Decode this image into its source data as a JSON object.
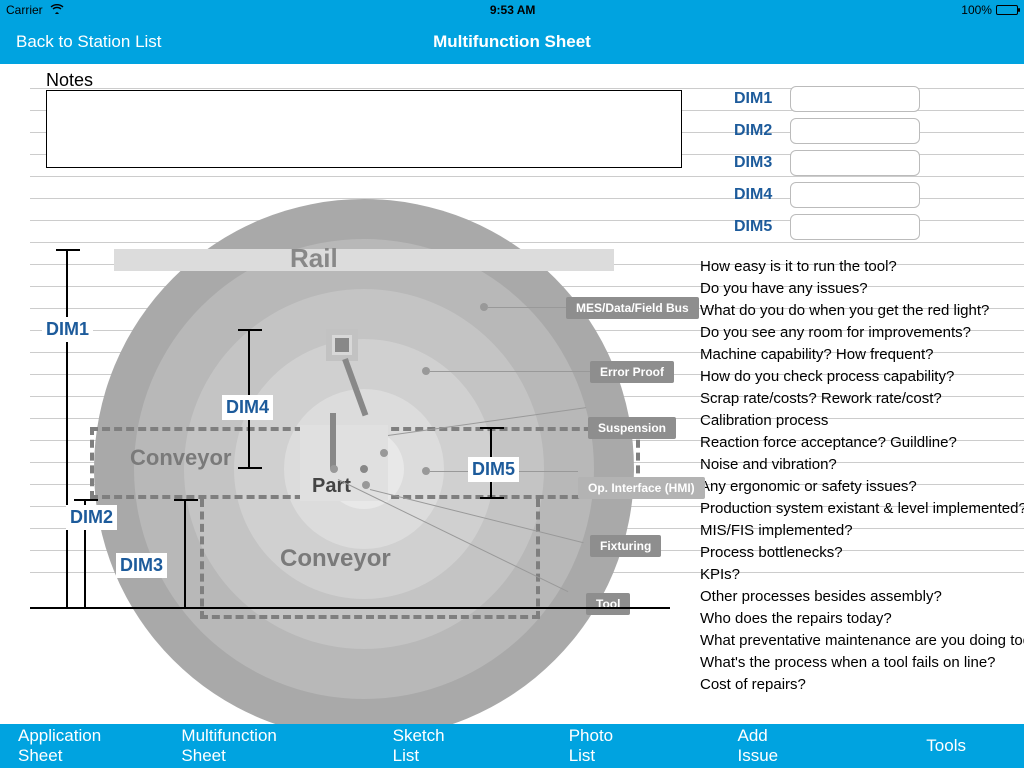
{
  "status": {
    "carrier": "Carrier",
    "time": "9:53 AM",
    "battery": "100%"
  },
  "nav": {
    "back": "Back to Station List",
    "title": "Multifunction Sheet"
  },
  "notes": {
    "label": "Notes",
    "value": ""
  },
  "dims": {
    "d1": {
      "label": "DIM1",
      "value": ""
    },
    "d2": {
      "label": "DIM2",
      "value": ""
    },
    "d3": {
      "label": "DIM3",
      "value": ""
    },
    "d4": {
      "label": "DIM4",
      "value": ""
    },
    "d5": {
      "label": "DIM5",
      "value": ""
    }
  },
  "diagram": {
    "rail": "Rail",
    "conveyor1": "Conveyor",
    "conveyor2": "Conveyor",
    "part": "Part",
    "dim1": "DIM1",
    "dim2": "DIM2",
    "dim3": "DIM3",
    "dim4": "DIM4",
    "dim5": "DIM5",
    "callouts": {
      "mes": "MES/Data/Field Bus",
      "error": "Error Proof",
      "suspension": "Suspension",
      "hmi": "Op. Interface (HMI)",
      "fixturing": "Fixturing",
      "tool": "Tool"
    }
  },
  "questions": [
    "How easy is it to run the tool?",
    "Do you have any issues?",
    "What do you do when you get the red light?",
    "Do you see any room for improvements?",
    "Machine capability? How frequent?",
    "How do you check process capability?",
    "Scrap rate/costs? Rework rate/cost?",
    "Calibration process",
    "Reaction force acceptance? Guildline?",
    "Noise and vibration?",
    "Any ergonomic or safety issues?",
    "Production system existant & level implemented?",
    "MIS/FIS implemented?",
    "Process bottlenecks?",
    "KPIs?",
    "Other processes besides assembly?",
    "Who does the repairs today?",
    "What preventative maintenance are you doing today?",
    "What's the process when a tool fails on line?",
    "Cost of repairs?"
  ],
  "toolbar": {
    "app": "Application Sheet",
    "multi": "Multifunction Sheet",
    "sketch": "Sketch List",
    "photo": "Photo List",
    "issue": "Add Issue",
    "tools": "Tools"
  }
}
